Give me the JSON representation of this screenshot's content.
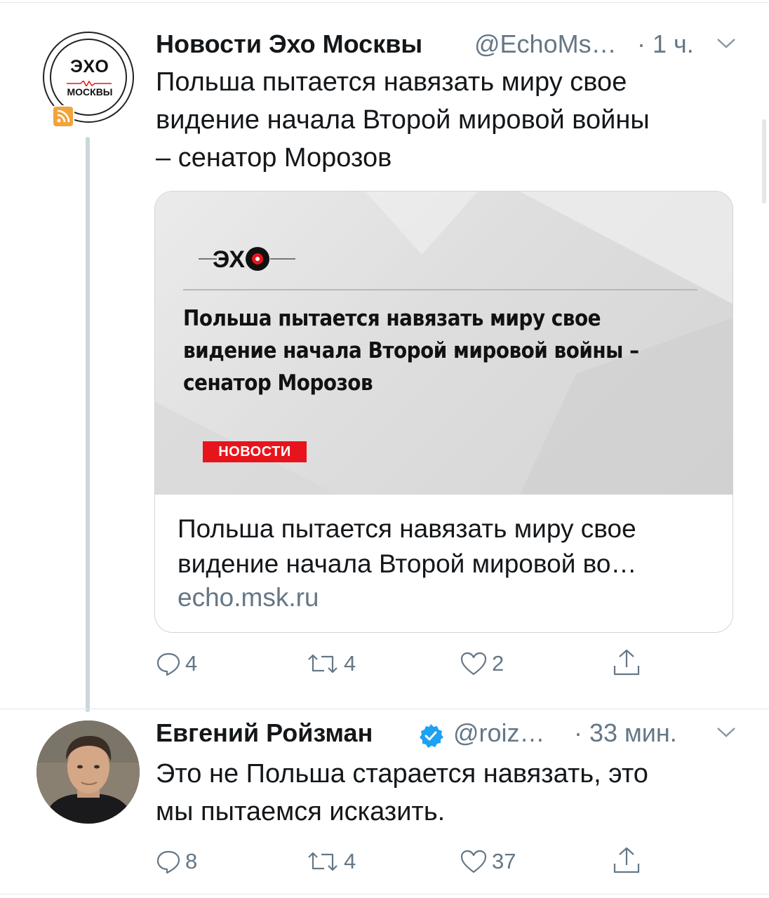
{
  "tweet1": {
    "avatar": {
      "brand_top": "ЭХО",
      "brand_bottom": "МОСКВЫ",
      "badge": "rss-icon"
    },
    "author_name": "Новости Эхо Москвы",
    "handle": "@EchoMs…",
    "time": "· 1 ч.",
    "text_lines": [
      "Польша пытается навязать миру свое",
      "видение начала Второй мировой войны",
      "– сенатор Морозов"
    ],
    "card": {
      "image_headline_lines": [
        "Польша пытается навязать миру свое",
        "видение начала Второй мировой войны –",
        "сенатор Морозов"
      ],
      "image_tag": "НОВОСТИ",
      "title_lines": [
        "Польша пытается навязать миру свое",
        "видение начала Второй мировой во…"
      ],
      "domain": "echo.msk.ru"
    },
    "actions": {
      "replies": "4",
      "retweets": "4",
      "likes": "2"
    }
  },
  "tweet2": {
    "author_name": "Евгений Ройзман",
    "verified": true,
    "handle": "@roiz…",
    "time": "· 33 мин.",
    "text_lines": [
      "Это не Польша старается навязать, это",
      "мы пытаемся исказить."
    ],
    "actions": {
      "replies": "8",
      "retweets": "4",
      "likes": "37"
    }
  },
  "colors": {
    "text": "#14171a",
    "muted": "#657786",
    "border": "#ccd6dd",
    "verified": "#1da1f2",
    "tag": "#e8141b",
    "logo_red": "#e8141b"
  }
}
